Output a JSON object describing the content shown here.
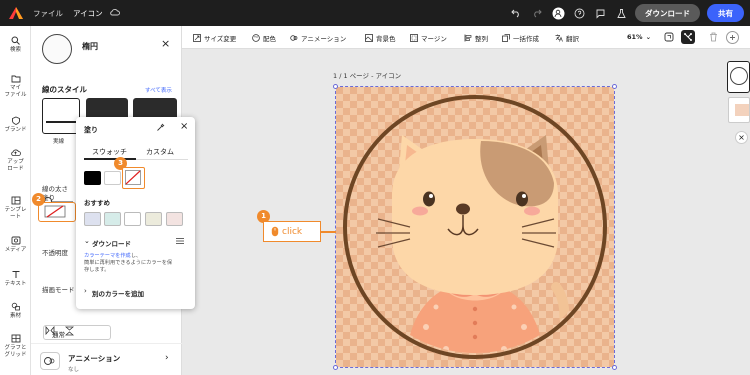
{
  "topbar": {
    "file_label": "ファイル",
    "doc_title": "アイコン",
    "download_label": "ダウンロード",
    "share_label": "共有"
  },
  "rail": {
    "items": [
      {
        "label": "検索",
        "icon": "search-icon"
      },
      {
        "label": "マイ\nファイル",
        "icon": "folder-icon"
      },
      {
        "label": "ブランド",
        "icon": "brand-icon"
      },
      {
        "label": "アップ\nロード",
        "icon": "upload-icon"
      },
      {
        "label": "テンプレ\nート",
        "icon": "template-icon"
      },
      {
        "label": "メディア",
        "icon": "media-icon"
      },
      {
        "label": "テキスト",
        "icon": "text-icon"
      },
      {
        "label": "素材",
        "icon": "elements-icon"
      },
      {
        "label": "グラフと\nグリッド",
        "icon": "grid-icon"
      }
    ]
  },
  "panel": {
    "shape_name": "楕円",
    "stroke_style_title": "線のスタイル",
    "see_all": "すべて表示",
    "stroke_option_label": "実線",
    "stroke_width_label": "線の太さ",
    "fill_label": "塗り",
    "opacity_label": "不透明度",
    "blend_label": "描画モード",
    "blend_value": "通常",
    "animation_title": "アニメーション",
    "animation_value": "なし"
  },
  "popup": {
    "title": "塗り",
    "tab_swatch": "スウォッチ",
    "tab_custom": "カスタム",
    "recommended": "おすすめ",
    "download_section": "ダウンロード",
    "theme_link": "カラーテーマを作成",
    "theme_text_suffix": "し、",
    "theme_text_2": "簡単に再利用できるようにカラーを保",
    "theme_text_3": "存します。",
    "add_color": "別のカラーを追加",
    "swatches": [
      "#000000",
      "#ffffff",
      "none"
    ],
    "recommended_colors": [
      "#dde1ef",
      "#d6ece9",
      "#ffffff",
      "#ecebdc",
      "#f3e3e1"
    ]
  },
  "badges": [
    "1",
    "2",
    "3"
  ],
  "toolbar": {
    "tools": [
      "サイズ変更",
      "配色",
      "アニメーション",
      "背景色",
      "マージン",
      "整列",
      "一括作成",
      "翻訳"
    ],
    "zoom": "61%"
  },
  "canvas": {
    "page_label": "1 / 1 ページ - アイコン",
    "click_label": "click"
  },
  "colors": {
    "accent": "#3b63fb",
    "highlight": "#f08a2c",
    "ring": "#6e4624",
    "cat_face": "#fdd7a8",
    "cat_patch": "#c99b74",
    "shirt": "#f7a27b"
  }
}
